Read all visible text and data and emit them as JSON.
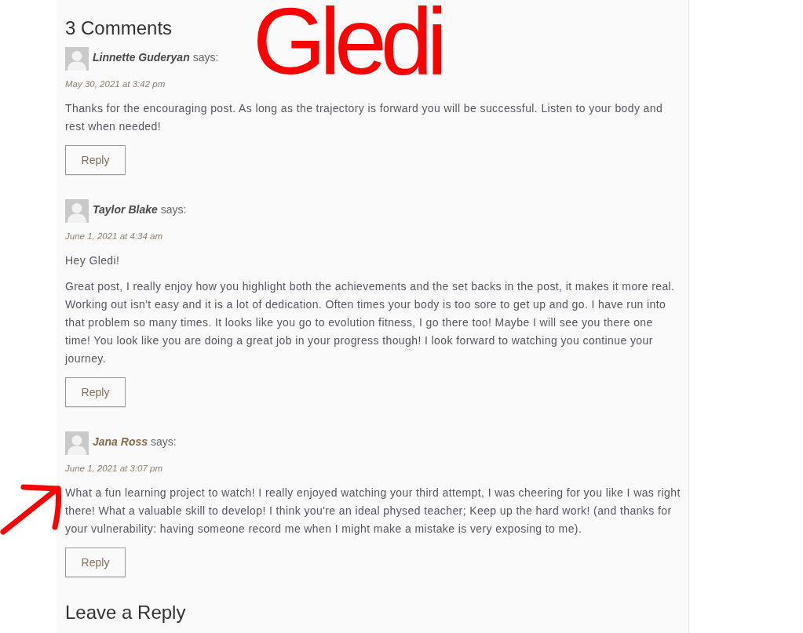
{
  "comments_section": {
    "title": "3 Comments"
  },
  "comments": [
    {
      "author": "Linnette Guderyan",
      "linked": false,
      "says": "says:",
      "date": "May 30, 2021 at 3:42 pm",
      "paragraphs": [
        "Thanks for the encouraging post. As long as the trajectory is forward you will be successful. Listen to your body and rest when needed!"
      ],
      "reply": "Reply"
    },
    {
      "author": "Taylor Blake",
      "linked": false,
      "says": "says:",
      "date": "June 1, 2021 at 4:34 am",
      "paragraphs": [
        "Hey Gledi!",
        "Great post, I really enjoy how you highlight both the achievements and the set backs in the post, it makes it more real. Working out isn't easy and it is a lot of dedication. Often times your body is too sore to get up and go. I have run into that problem so many times. It looks like you go to evolution fitness, I go there too! Maybe I will see you there one time! You look like you are doing a great job in your progress though! I look forward to watching you continue your journey."
      ],
      "reply": "Reply"
    },
    {
      "author": "Jana Ross",
      "linked": true,
      "says": "says:",
      "date": "June 1, 2021 at 3:07 pm",
      "paragraphs": [
        "What a fun learning project to watch! I really enjoyed watching your third attempt, I was cheering for you like I was right there! What a valuable skill to develop! I think you're an ideal physed teacher; Keep up the hard work! (and thanks for your vulnerability: having someone record me when I might make a mistake is very exposing to me)."
      ],
      "reply": "Reply"
    }
  ],
  "reply_section": {
    "title": "Leave a Reply"
  },
  "annotations": [
    {
      "kind": "handwriting",
      "text": "Gledi"
    },
    {
      "kind": "arrow"
    }
  ]
}
